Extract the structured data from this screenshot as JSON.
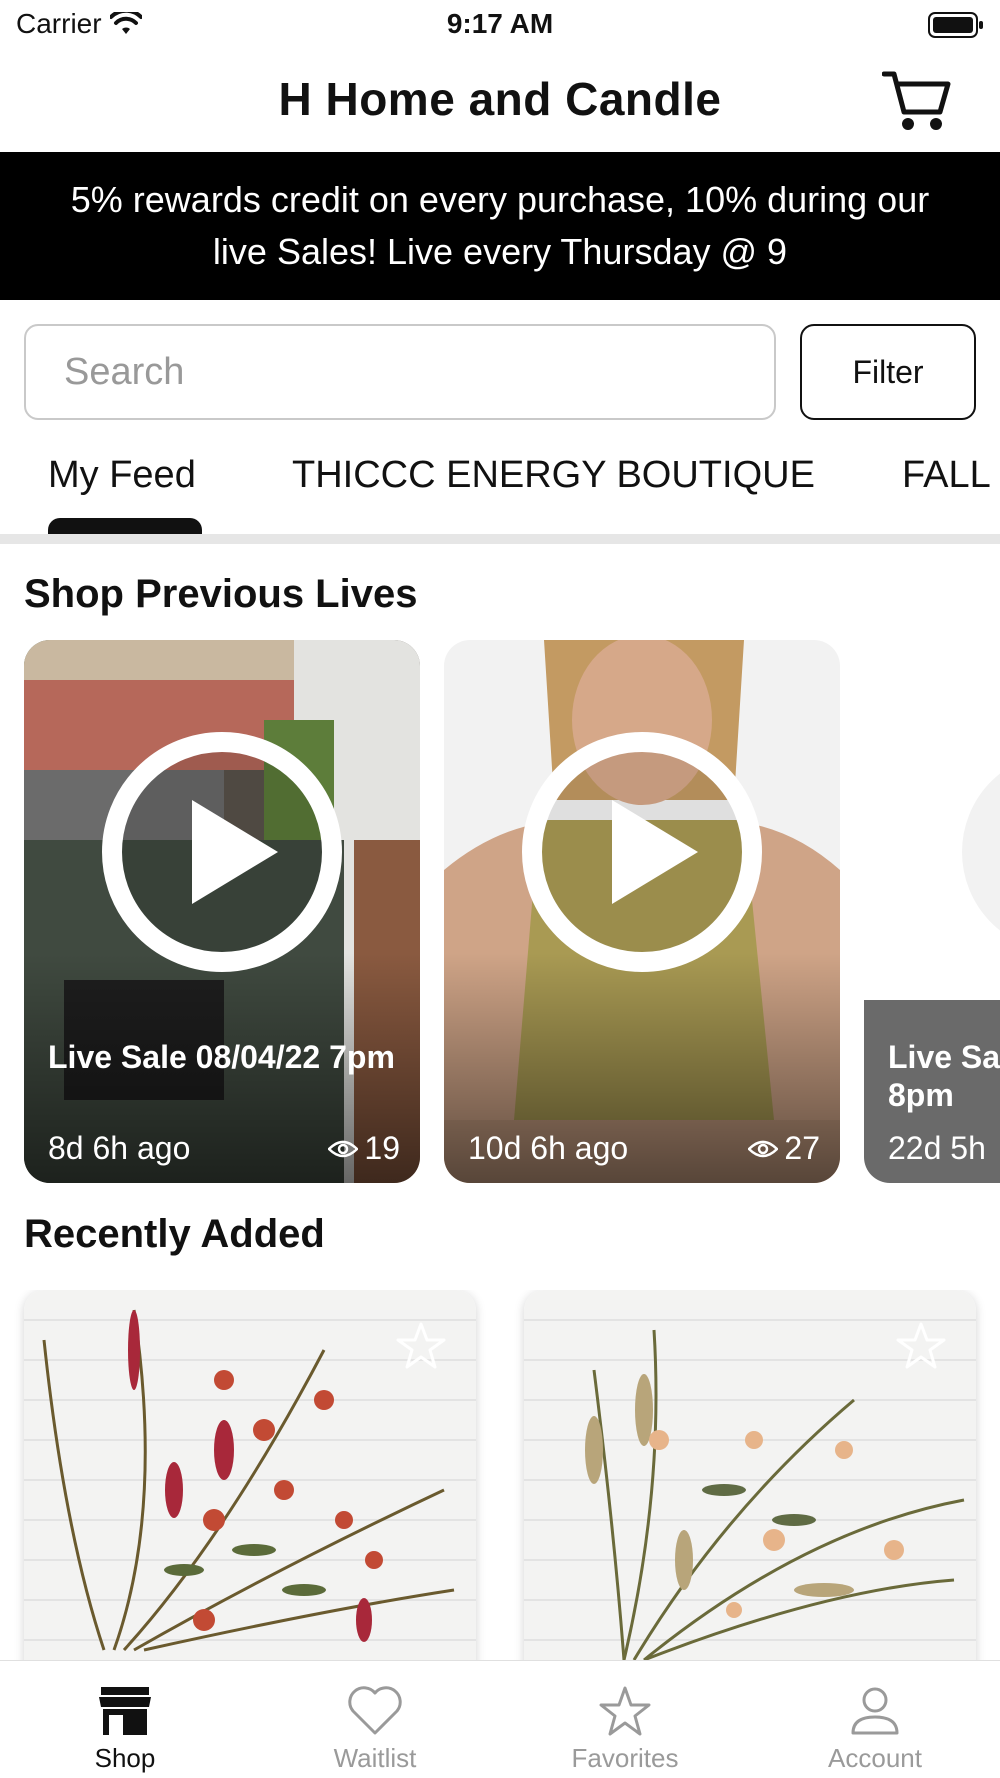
{
  "status_bar": {
    "carrier": "Carrier",
    "time": "9:17 AM"
  },
  "header": {
    "title": "H Home and Candle",
    "cart_icon": "cart-icon"
  },
  "banner": {
    "text": "5% rewards credit on every purchase, 10% during our live Sales! Live every Thursday @ 9"
  },
  "search": {
    "placeholder": "Search",
    "filter_label": "Filter"
  },
  "tabs": [
    {
      "label": "My Feed",
      "active": true
    },
    {
      "label": "THICCC ENERGY BOUTIQUE",
      "active": false
    },
    {
      "label": "FALL",
      "active": false
    }
  ],
  "previous_lives": {
    "title": "Shop Previous Lives",
    "items": [
      {
        "title": "Live Sale 08/04/22 7pm",
        "ago": "8d 6h ago",
        "views": "19"
      },
      {
        "title": "",
        "ago": "10d 6h ago",
        "views": "27"
      },
      {
        "title": "Live Sa 8pm",
        "ago": "22d 5h",
        "views": ""
      }
    ]
  },
  "recently_added": {
    "title": "Recently Added",
    "items": [
      {
        "favorite_icon": "star-icon"
      },
      {
        "favorite_icon": "star-icon"
      }
    ]
  },
  "tab_bar": [
    {
      "label": "Shop",
      "icon": "storefront-icon",
      "active": true
    },
    {
      "label": "Waitlist",
      "icon": "heart-icon",
      "active": false
    },
    {
      "label": "Favorites",
      "icon": "star-icon",
      "active": false
    },
    {
      "label": "Account",
      "icon": "person-icon",
      "active": false
    }
  ],
  "colors": {
    "banner_bg": "#000000",
    "active": "#111111",
    "inactive": "#9a9a9a"
  }
}
